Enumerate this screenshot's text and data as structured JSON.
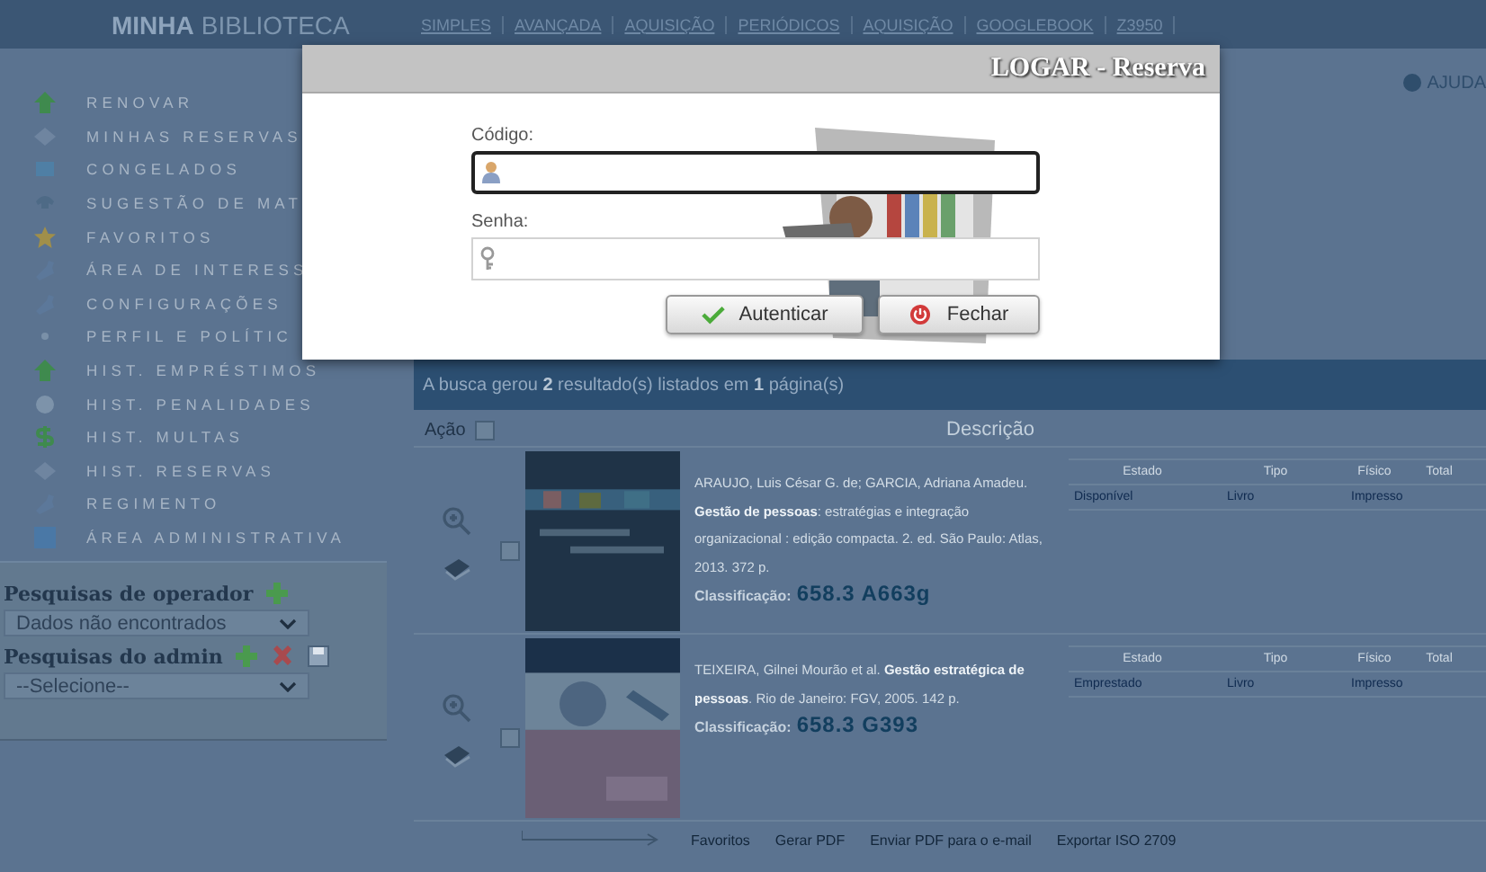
{
  "header": {
    "title_bold": "MINHA",
    "title_light": "BIBLIOTECA",
    "nav": [
      "SIMPLES",
      "AVANÇADA",
      "AQUISIÇÃO",
      "PERIÓDICOS",
      "AQUISIÇÃO",
      "GOOGLEBOOK",
      "Z3950"
    ]
  },
  "help": "AJUDA",
  "sidebar": {
    "items": [
      "RENOVAR",
      "MINHAS RESERVAS",
      "CONGELADOS",
      "SUGESTÃO DE MAT",
      "FAVORITOS",
      "ÁREA DE INTERESS",
      "CONFIGURAÇÕES",
      "PERFIL E POLÍTIC",
      "HIST. EMPRÉSTIMOS",
      "HIST. PENALIDADES",
      "HIST. MULTAS",
      "HIST. RESERVAS",
      "REGIMENTO",
      "ÁREA ADMINISTRATIVA"
    ],
    "operator_searches": {
      "label": "Pesquisas de operador",
      "select": "Dados não encontrados"
    },
    "admin_searches": {
      "label": "Pesquisas do admin",
      "select": "--Selecione--"
    }
  },
  "dialog": {
    "title": "LOGAR - Reserva",
    "code_label": "Código:",
    "password_label": "Senha:",
    "buttons": [
      "Autenticar",
      "Fechar"
    ]
  },
  "results": {
    "summary": "A busca gerou **2** resultado(s) listados em **1** página(s)",
    "columns": [
      "Ação",
      "Descrição"
    ],
    "select_all": false,
    "rows": [
      {
        "checked": false,
        "reference": "ARAUJO, Luis César G. de; GARCIA, Adriana Amadeu. **Gestão de pessoas**: estratégias e integração organizacional : edição compacta. 2. ed. São Paulo: Atlas, 2013. 372 p.",
        "classification_label": "Classificação:",
        "classification": "658.3 A663g",
        "holdings": {
          "columns": [
            "Estado",
            "Tipo",
            "Físico",
            "Total"
          ],
          "values": [
            "Disponível",
            "Livro",
            "Impresso"
          ]
        }
      },
      {
        "checked": false,
        "reference": "TEIXEIRA, Gilnei Mourão et al. **Gestão estratégica de pessoas**. Rio de Janeiro: FGV, 2005. 142 p.",
        "classification_label": "Classificação:",
        "classification": "658.3 G393",
        "holdings": {
          "columns": [
            "Estado",
            "Tipo",
            "Físico",
            "Total"
          ],
          "values": [
            "Emprestado",
            "Livro",
            "Impresso"
          ]
        }
      }
    ]
  },
  "footer_links": [
    "Favoritos",
    "Gerar PDF",
    "Enviar PDF para o e-mail",
    "Exportar ISO 2709"
  ]
}
